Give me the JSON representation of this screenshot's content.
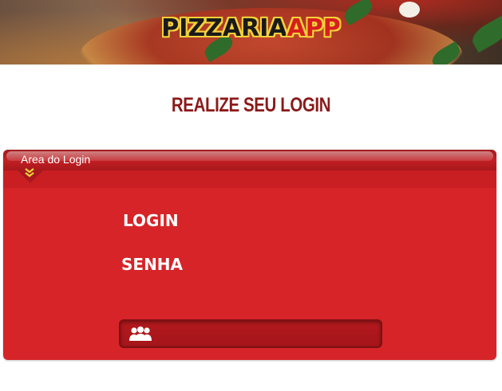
{
  "header": {
    "logo_part1": "PIZZARIA",
    "logo_part2": "APP",
    "colors": {
      "logo_outline": "#f5d23a",
      "logo_dark": "#1a1a1a",
      "logo_red": "#d81e1e"
    }
  },
  "page": {
    "title": "REALIZE SEU LOGIN",
    "title_color": "#8b1a1a"
  },
  "login_panel": {
    "title": "Area do Login",
    "chevron_icon": "chevron-double-down-icon",
    "login_label": "LOGIN",
    "password_label": "SENHA",
    "submit_icon": "users-icon",
    "colors": {
      "panel": "#d62428",
      "header": "#a8181c",
      "text": "#ffffff"
    }
  }
}
